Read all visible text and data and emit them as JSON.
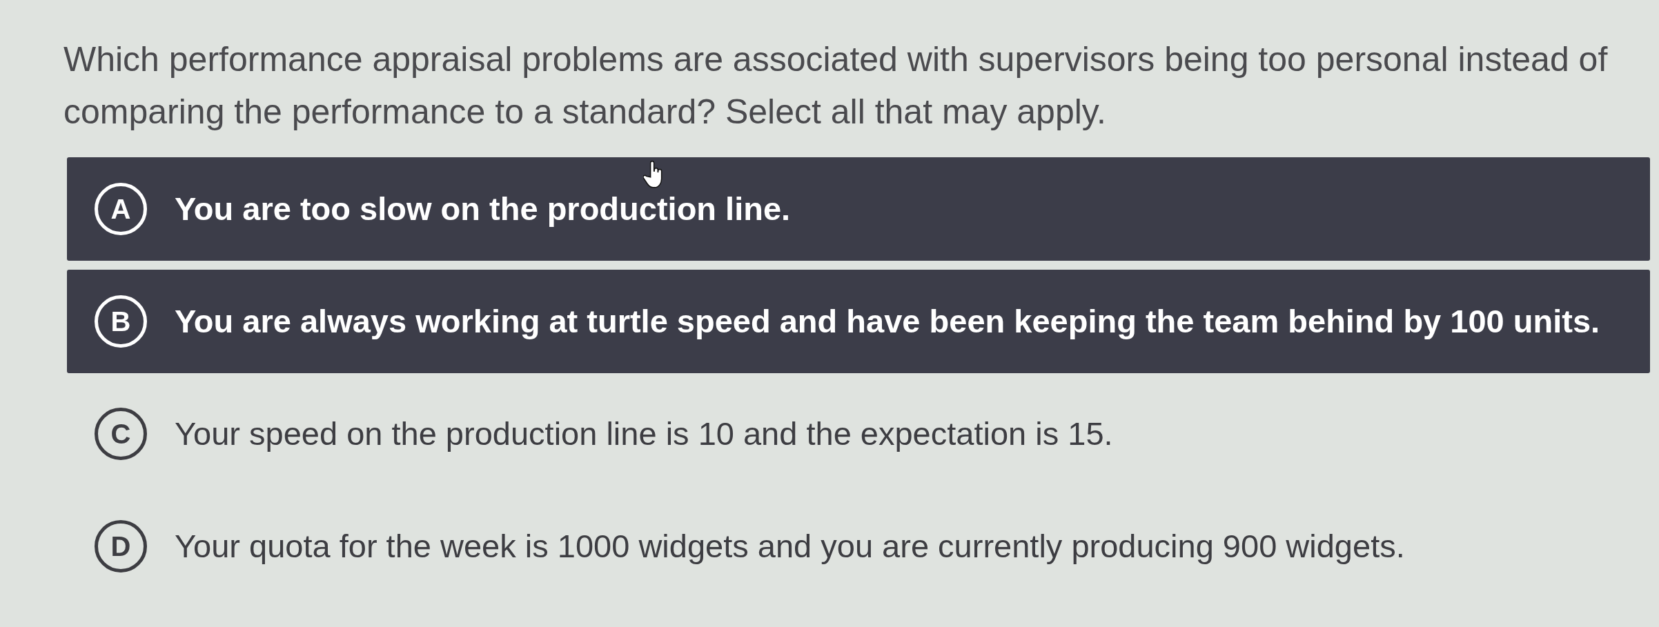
{
  "question": "Which performance appraisal problems are associated with supervisors being too personal instead of comparing the performance to a standard? Select all that may apply.",
  "options": [
    {
      "letter": "A",
      "text": "You are too slow on the production line.",
      "selected": true
    },
    {
      "letter": "B",
      "text": "You are always working at turtle speed and have been keeping the team behind by 100 units.",
      "selected": true
    },
    {
      "letter": "C",
      "text": "Your speed on the production line is 10 and the expectation is 15.",
      "selected": false
    },
    {
      "letter": "D",
      "text": "Your quota for the week is 1000 widgets and you are currently producing 900 widgets.",
      "selected": false
    }
  ]
}
